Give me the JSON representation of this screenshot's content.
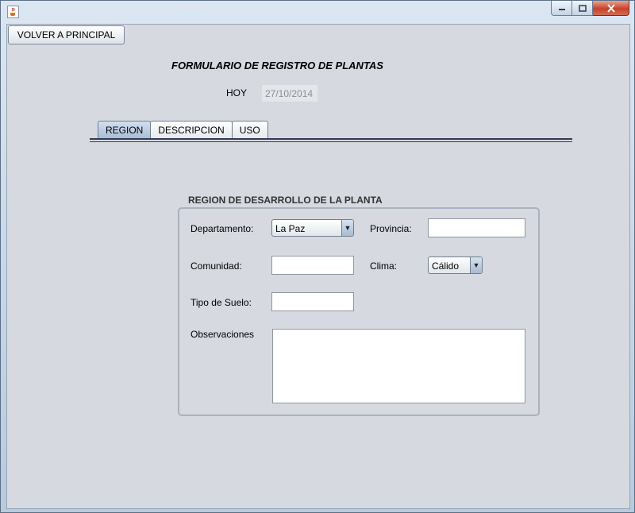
{
  "window": {
    "app_icon": "java-cup-icon",
    "controls": {
      "minimize": "minimize-icon",
      "maximize": "maximize-icon",
      "close": "close-icon"
    }
  },
  "toolbar": {
    "back_label": "VOLVER A PRINCIPAL"
  },
  "header": {
    "title": "FORMULARIO DE REGISTRO DE PLANTAS",
    "today_label": "HOY",
    "today_value": "27/10/2014"
  },
  "tabs": [
    {
      "label": "REGION",
      "selected": true
    },
    {
      "label": "DESCRIPCION",
      "selected": false
    },
    {
      "label": "USO",
      "selected": false
    }
  ],
  "region_panel": {
    "title": "REGION DE DESARROLLO DE LA PLANTA",
    "departamento_label": "Departamento:",
    "departamento_value": "La Paz",
    "provincia_label": "Provincia:",
    "provincia_value": "",
    "comunidad_label": "Comunidad:",
    "comunidad_value": "",
    "clima_label": "Clima:",
    "clima_value": "Cálido",
    "tipo_suelo_label": "Tipo de Suelo:",
    "tipo_suelo_value": "",
    "observaciones_label": "Observaciones",
    "observaciones_value": ""
  },
  "colors": {
    "selected_tab": "#a6bcd6",
    "panel_background": "#d6d9df",
    "close_button": "#c7422a"
  }
}
